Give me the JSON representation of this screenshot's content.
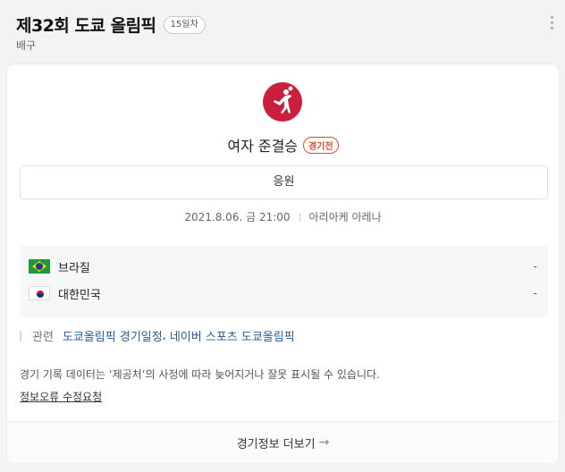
{
  "header": {
    "title": "제32회 도쿄 올림픽",
    "day_badge": "15일차",
    "subtitle": "배구"
  },
  "match": {
    "event_name": "여자 준결승",
    "status": "경기전",
    "cheer_button": "응원",
    "datetime": "2021.8.06. 금 21:00",
    "venue": "아리아케 아레나",
    "sport_icon": "volleyball-icon",
    "sport_icon_color": "#cc1f3f"
  },
  "teams": [
    {
      "name": "브라질",
      "score": "-",
      "flag": "brazil-flag-icon"
    },
    {
      "name": "대한민국",
      "score": "-",
      "flag": "korea-flag-icon"
    }
  ],
  "related": {
    "label": "관련",
    "links": [
      "도쿄올림픽 경기일정",
      "네이버 스포츠 도쿄올림픽"
    ]
  },
  "notice": "경기 기록 데이터는 ‘제공처’의 사정에 따라 늦어지거나 잘못 표시될 수 있습니다.",
  "report_link": "정보오류 수정요청",
  "footer": {
    "more_label": "경기정보 더보기"
  }
}
